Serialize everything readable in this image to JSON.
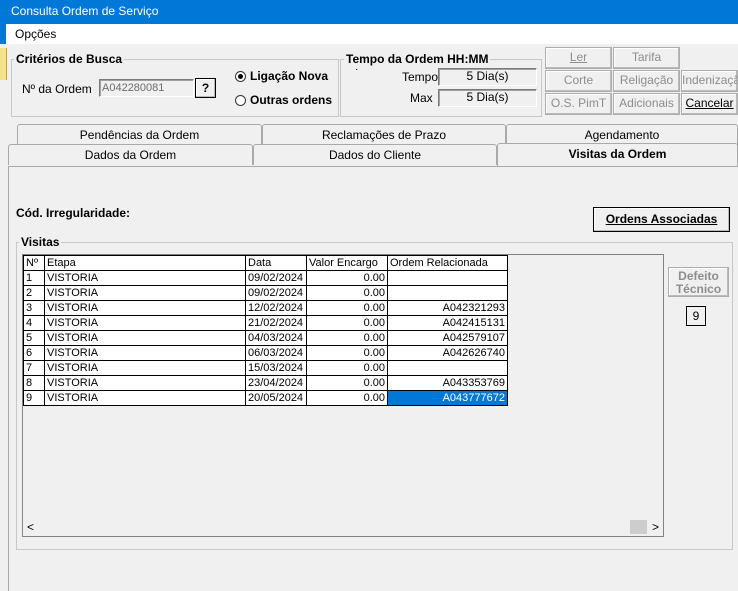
{
  "window": {
    "title": "Consulta Ordem de Serviço"
  },
  "menu": {
    "options": "Opções"
  },
  "criteria": {
    "legend": "Critérios de Busca",
    "order_label": "Nº da Ordem",
    "order_value": "A042280081",
    "lookup_button": "?",
    "radio_new": "Ligação Nova",
    "radio_other": "Outras ordens"
  },
  "time": {
    "legend": "Tempo da Ordem HH:MM",
    "dot": "·",
    "tempo_label": "Tempo",
    "tempo_value": "5 Dia(s)",
    "max_label": "Max",
    "max_value": "5 Dia(s)"
  },
  "toolbar": {
    "ler": "Ler",
    "tarifa": "Tarifa",
    "corte": "Corte",
    "religacao": "Religação",
    "indenizacao": "Indenizaçã",
    "ospimt": "O.S. PimT",
    "adicionais": "Adicionais",
    "cancelar": "Cancelar"
  },
  "tabs_row1": [
    "Pendências da Ordem",
    "Reclamações de Prazo",
    "Agendamento"
  ],
  "tabs_row2": [
    "Dados da Ordem",
    "Dados do Cliente",
    "Visitas da Ordem"
  ],
  "content": {
    "irregularity_label": "Cód. Irregularidade:",
    "associated_button": "Ordens Associadas",
    "visits_legend": "Visitas",
    "defect_button": "Defeito Técnico",
    "defect_count": "9"
  },
  "table": {
    "headers": [
      "Nº",
      "Etapa",
      "Data",
      "Valor Encargo",
      "Ordem Relacionada"
    ],
    "rows": [
      [
        "1",
        "VISTORIA",
        "09/02/2024",
        "0.00",
        ""
      ],
      [
        "2",
        "VISTORIA",
        "09/02/2024",
        "0.00",
        ""
      ],
      [
        "3",
        "VISTORIA",
        "12/02/2024",
        "0.00",
        "A042321293"
      ],
      [
        "4",
        "VISTORIA",
        "21/02/2024",
        "0.00",
        "A042415131"
      ],
      [
        "5",
        "VISTORIA",
        "04/03/2024",
        "0.00",
        "A042579107"
      ],
      [
        "6",
        "VISTORIA",
        "06/03/2024",
        "0.00",
        "A042626740"
      ],
      [
        "7",
        "VISTORIA",
        "15/03/2024",
        "0.00",
        ""
      ],
      [
        "8",
        "VISTORIA",
        "23/04/2024",
        "0.00",
        "A043353769"
      ],
      [
        "9",
        "VISTORIA",
        "20/05/2024",
        "0.00",
        "A043777672"
      ]
    ],
    "selected_row": 8
  },
  "scrollbar": {
    "left_arrow": "<",
    "right_arrow": ">"
  },
  "colors": {
    "titlebar": "#0078d7",
    "selection": "#0078d7"
  }
}
